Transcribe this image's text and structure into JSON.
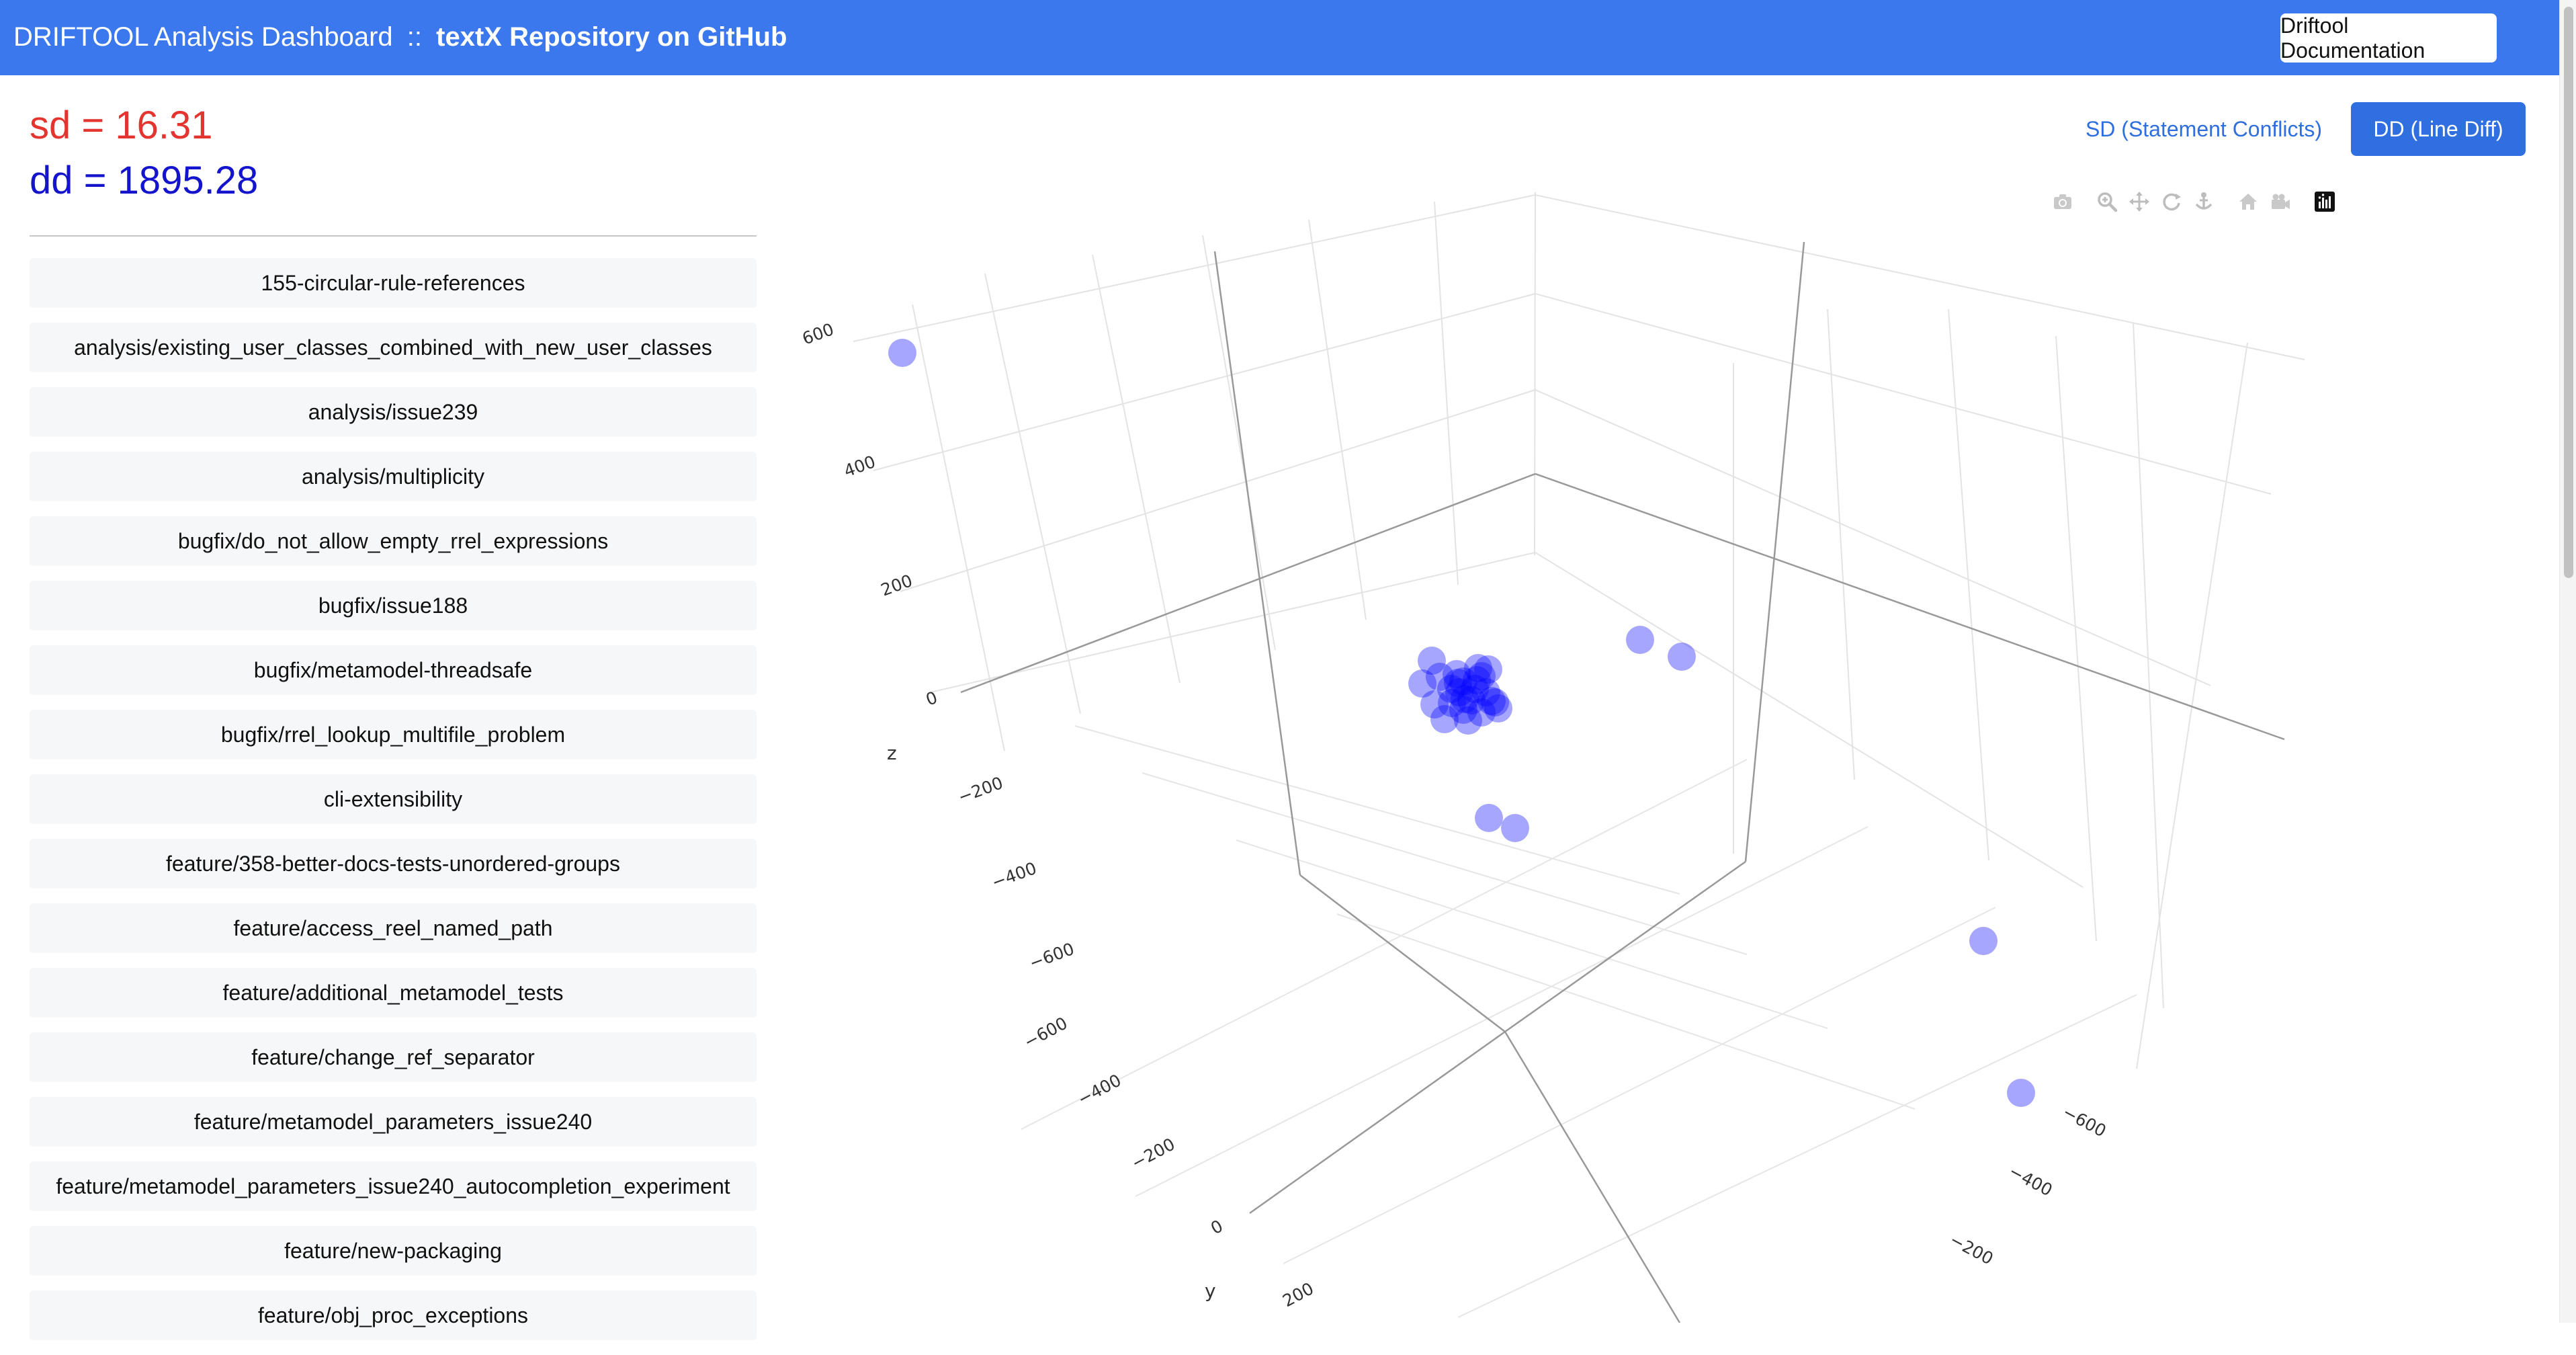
{
  "header": {
    "title_prefix": "DRIFTOOL Analysis Dashboard",
    "separator": "::",
    "repo_title": "textX Repository on GitHub",
    "doc_button": "Driftool Documentation"
  },
  "metrics": {
    "sd": "sd = 16.31",
    "dd": "dd = 1895.28"
  },
  "tabs": {
    "sd_label": "SD (Statement Conflicts)",
    "dd_label": "DD (Line Diff)",
    "active": "dd"
  },
  "branches": [
    "155-circular-rule-references",
    "analysis/existing_user_classes_combined_with_new_user_classes",
    "analysis/issue239",
    "analysis/multiplicity",
    "bugfix/do_not_allow_empty_rrel_expressions",
    "bugfix/issue188",
    "bugfix/metamodel-threadsafe",
    "bugfix/rrel_lookup_multifile_problem",
    "cli-extensibility",
    "feature/358-better-docs-tests-unordered-groups",
    "feature/access_reel_named_path",
    "feature/additional_metamodel_tests",
    "feature/change_ref_separator",
    "feature/metamodel_parameters_issue240",
    "feature/metamodel_parameters_issue240_autocompletion_experiment",
    "feature/new-packaging",
    "feature/obj_proc_exceptions"
  ],
  "modebar": {
    "icons": [
      "camera-icon",
      "zoom-icon",
      "pan-icon",
      "orbit-icon",
      "turntable-icon",
      "home-icon",
      "default-view-icon",
      "plotly-logo-icon"
    ]
  },
  "chart_data": {
    "type": "scatter",
    "dimensions": 3,
    "marker_color": "#0000ff",
    "marker_opacity": 0.35,
    "axes": {
      "z": {
        "label": "z",
        "ticks": [
          "−600",
          "−400",
          "−200",
          "0",
          "200",
          "400",
          "600"
        ]
      },
      "y": {
        "label": "y",
        "ticks": [
          "−600",
          "−400",
          "−200",
          "0",
          "200"
        ]
      },
      "x": {
        "ticks": [
          "−600",
          "−400",
          "−200"
        ]
      }
    },
    "grid": true,
    "point_count": 32
  }
}
